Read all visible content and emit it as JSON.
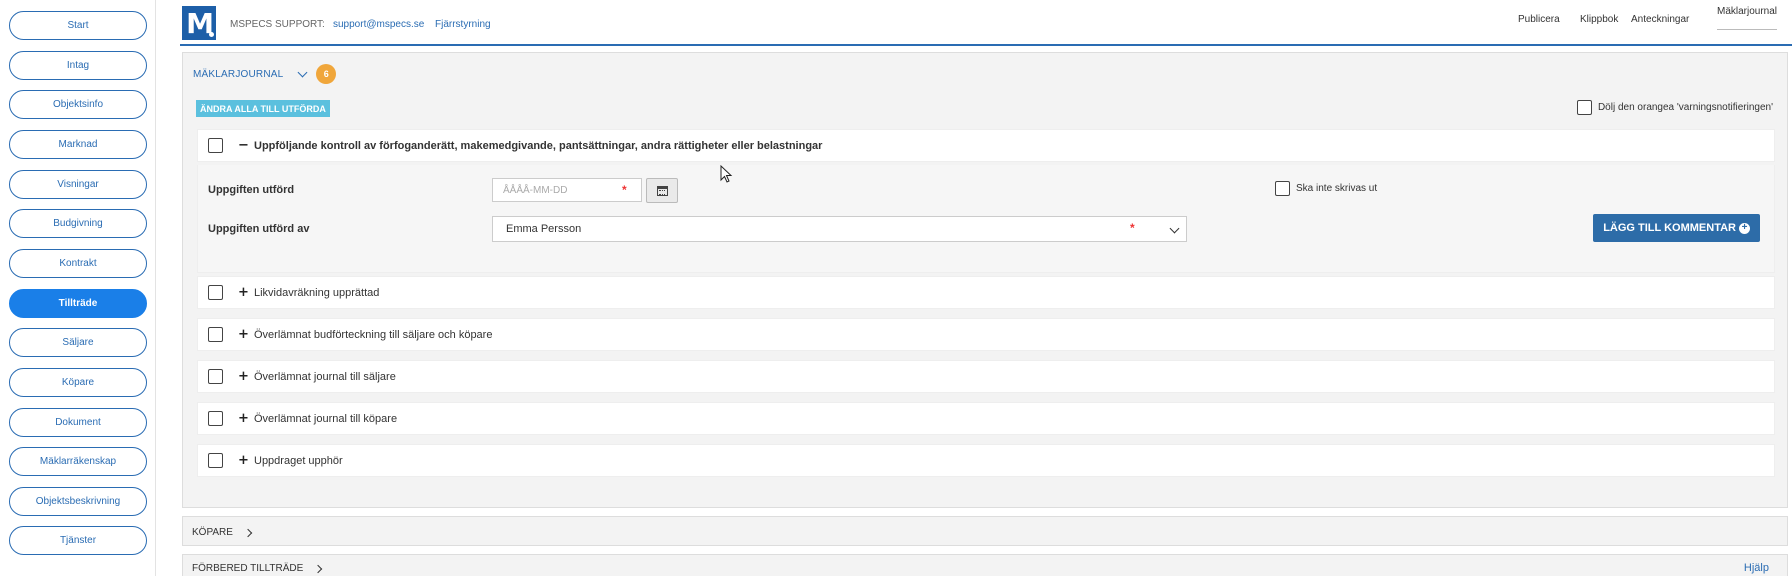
{
  "sidebar": {
    "items": [
      {
        "label": "Start",
        "active": false
      },
      {
        "label": "Intag",
        "active": false
      },
      {
        "label": "Objektsinfo",
        "active": false
      },
      {
        "label": "Marknad",
        "active": false
      },
      {
        "label": "Visningar",
        "active": false
      },
      {
        "label": "Budgivning",
        "active": false
      },
      {
        "label": "Kontrakt",
        "active": false
      },
      {
        "label": "Tillträde",
        "active": true
      },
      {
        "label": "Säljare",
        "active": false
      },
      {
        "label": "Köpare",
        "active": false
      },
      {
        "label": "Dokument",
        "active": false
      },
      {
        "label": "Mäklarräkenskap",
        "active": false
      },
      {
        "label": "Objektsbeskrivning",
        "active": false
      },
      {
        "label": "Tjänster",
        "active": false
      }
    ]
  },
  "topbar": {
    "logo_letter": "M",
    "support_label": "MSPECS SUPPORT:",
    "support_email": "support@mspecs.se",
    "remote_label": "Fjärrstyrning",
    "nav": [
      "Publicera",
      "Klippbok",
      "Anteckningar",
      "Mäklarjournal"
    ],
    "active_nav": "Mäklarjournal"
  },
  "journal": {
    "title": "MÄKLARJOURNAL",
    "badge_count": "6",
    "change_all_label": "ÄNDRA ALLA TILL UTFÖRDA",
    "hide_warning_label": "Dölj den orangea 'varningsnotifieringen'",
    "expanded_task": {
      "toggle": "−",
      "label": "Uppföljande kontroll av förfoganderätt, makemedgivande, pantsättningar, andra rättigheter eller belastningar",
      "done_label": "Uppgiften utförd",
      "date_placeholder": "ÅÅÅÅ-MM-DD",
      "required_mark": "*",
      "done_by_label": "Uppgiften utförd av",
      "done_by_value": "Emma Persson",
      "no_print_label": "Ska inte skrivas ut",
      "add_comment_label": "LÄGG TILL KOMMENTAR",
      "add_comment_icon": "+"
    },
    "tasks": [
      {
        "toggle": "+",
        "label": "Likvidavräkning upprättad"
      },
      {
        "toggle": "+",
        "label": "Överlämnat budförteckning till säljare och köpare"
      },
      {
        "toggle": "+",
        "label": "Överlämnat journal till säljare"
      },
      {
        "toggle": "+",
        "label": "Överlämnat journal till köpare"
      },
      {
        "toggle": "+",
        "label": "Uppdraget upphör"
      }
    ]
  },
  "panels": {
    "buyers_title": "KÖPARE",
    "prepare_title": "FÖRBERED TILLTRÄDE",
    "help_label": "Hjälp"
  },
  "colors": {
    "accent": "#2a6cb3",
    "active_sidebar": "#1a7fe8",
    "badge": "#f0a63a",
    "change_all": "#5bc0de",
    "required": "#e33333"
  }
}
